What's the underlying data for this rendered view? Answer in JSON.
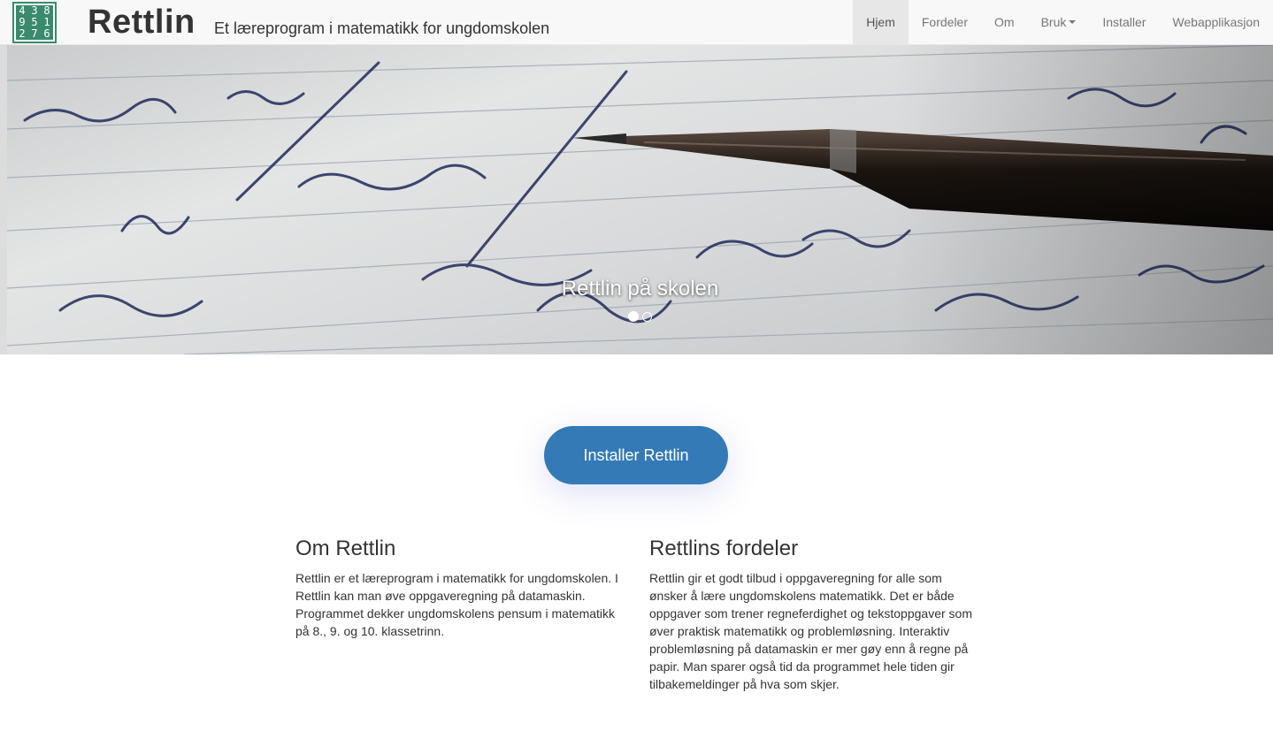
{
  "navbar": {
    "logo_digits": [
      "4",
      "3",
      "8",
      "9",
      "5",
      "1",
      "2",
      "7",
      "6"
    ],
    "brand": "Rettlin",
    "tagline": "Et læreprogram i matematikk for ungdomskolen",
    "items": [
      {
        "label": "Hjem",
        "active": true
      },
      {
        "label": "Fordeler"
      },
      {
        "label": "Om"
      },
      {
        "label": "Bruk",
        "dropdown": true
      },
      {
        "label": "Installer"
      },
      {
        "label": "Webapplikasjon"
      }
    ]
  },
  "hero": {
    "caption": "Rettlin på skolen",
    "slide_count": 2,
    "active_slide": 1
  },
  "install_button": "Installer Rettlin",
  "sections": {
    "about": {
      "title": "Om Rettlin",
      "body": "Rettlin er et læreprogram i matematikk for ungdomskolen. I Rettlin kan man øve oppgaveregning på datamaskin. Programmet dekker ungdomskolens pensum i matematikk på 8., 9. og 10. klassetrinn."
    },
    "benefits": {
      "title": "Rettlins fordeler",
      "body": "Rettlin gir et godt tilbud i oppgaveregning for alle som ønsker å lære ungdomskolens matematikk. Det er både oppgaver som trener regneferdighet og tekstoppgaver som øver praktisk matematikk og problemløsning. Interaktiv problemløsning på datamaskin er mer gøy enn å regne på papir. Man sparer også tid da programmet hele tiden gir tilbakemeldinger på hva som skjer."
    }
  },
  "colors": {
    "primary": "#337ab7",
    "logo_green": "#3a8a6e",
    "navbar_bg": "#f8f8f8"
  }
}
